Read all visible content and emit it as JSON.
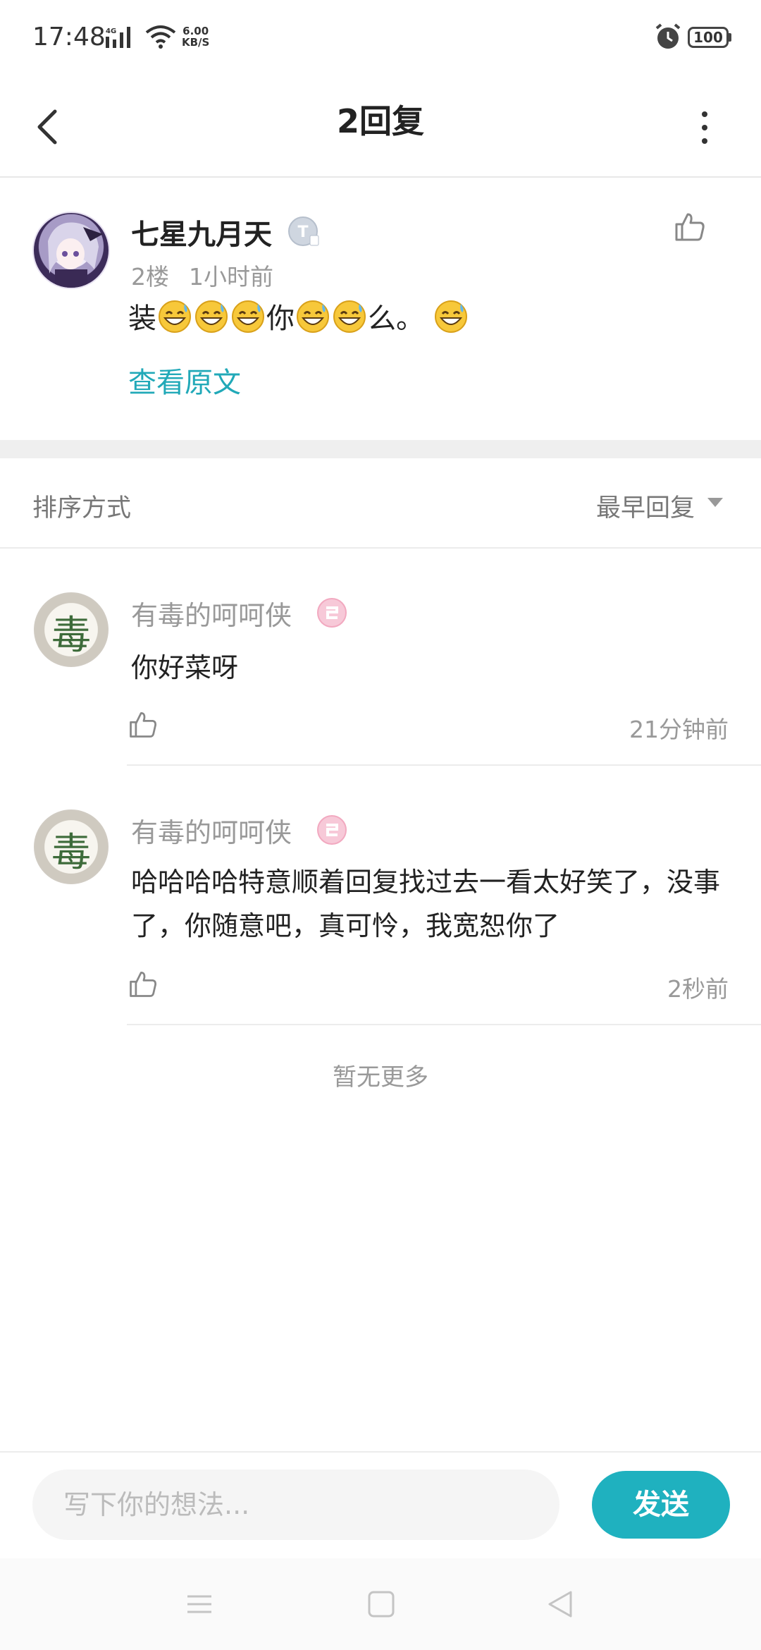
{
  "status_bar": {
    "time": "17:48",
    "network": "4G",
    "net_speed_value": "6.00",
    "net_speed_unit": "KB/S",
    "battery": "100"
  },
  "header": {
    "title": "2回复"
  },
  "post": {
    "author": "七星九月天",
    "badge": "T",
    "floor": "2楼",
    "time": "1小时前",
    "content_parts": [
      "装",
      "你",
      "么。"
    ],
    "view_original": "查看原文"
  },
  "sort": {
    "label": "排序方式",
    "selected": "最早回复"
  },
  "replies": [
    {
      "user": "有毒的呵呵侠",
      "text": "你好菜呀",
      "time": "21分钟前",
      "avatar_glyph": "毒"
    },
    {
      "user": "有毒的呵呵侠",
      "text": "哈哈哈哈特意顺着回复找过去一看太好笑了，没事了，你随意吧，真可怜，我宽恕你了",
      "time": "2秒前",
      "avatar_glyph": "毒"
    }
  ],
  "no_more": "暂无更多",
  "composer": {
    "placeholder": "写下你的想法...",
    "send_label": "发送"
  },
  "colors": {
    "accent": "#1fb1bf",
    "link": "#21a9b8",
    "muted_text": "#999999"
  },
  "icons": [
    "back-arrow-icon",
    "more-vert-icon",
    "thumb-up-icon",
    "grin-sweat-emoji",
    "menu-icon",
    "home-square-icon",
    "back-triangle-icon"
  ]
}
